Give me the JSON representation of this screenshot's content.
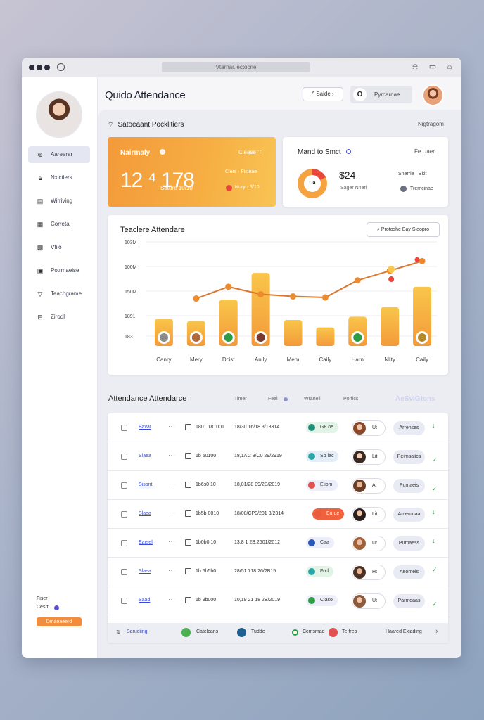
{
  "browser": {
    "url": "Vtarnar.lectocrie"
  },
  "app": {
    "title": "Quido Attendance",
    "header_button": "Saide",
    "search_placeholder": "Pyrcarnae"
  },
  "sidebar": {
    "items": [
      {
        "label": "Aareerar",
        "icon": "plus-circle-icon",
        "active": true
      },
      {
        "label": "Nxictiers",
        "icon": "lock-icon"
      },
      {
        "label": "Wirriving",
        "icon": "calendar-icon"
      },
      {
        "label": "Corretal",
        "icon": "calendar-grid-icon"
      },
      {
        "label": "Vtiio",
        "icon": "grid-icon"
      },
      {
        "label": "Potrmaeise",
        "icon": "image-icon"
      },
      {
        "label": "Teachgrame",
        "icon": "shield-icon"
      },
      {
        "label": "Zirodl",
        "icon": "inbox-icon"
      }
    ],
    "footer_line1": "Fiser",
    "footer_line2": "Cesrt",
    "footer_button": "Dmaeaeerd"
  },
  "overview": {
    "title": "Satoeaant Pocklitiers",
    "right_label": "Nigtragom"
  },
  "card_orange": {
    "title": "Nairmaly",
    "right": "Ciease ∷",
    "big_value": "12 ⁴ 178",
    "sub": "Sature 10/10",
    "meta1": "Clers · Fisieae",
    "meta2": "Nury · 3/10"
  },
  "card_white": {
    "title": "Mand to Smct",
    "right": "Fe Uaer",
    "donut_label": "Ua",
    "big_value": "$24",
    "sub": "Sager Nnerl",
    "meta1": "Snerrie · Bkit",
    "meta2": "Tremcinae"
  },
  "chart": {
    "title": "Teaclere Attendare",
    "button": "Protoshe Bay Sleopro"
  },
  "chart_data": {
    "type": "bar",
    "categories": [
      "Canry",
      "Mery",
      "Dcist",
      "Auily",
      "Mem",
      "Caily",
      "Harn",
      "Nlity",
      "Caily"
    ],
    "ytick_labels": [
      "103M",
      "100M",
      "150M",
      "1891",
      "183"
    ],
    "ylim": [
      0,
      100
    ],
    "series": [
      {
        "values": [
          28,
          26,
          46,
          71,
          27,
          20,
          30,
          39,
          58
        ]
      },
      {
        "values": [
          null,
          47,
          58,
          51,
          49,
          48,
          64,
          73,
          82
        ]
      }
    ],
    "colors": {
      "bar": "#f6a93c",
      "line": "#d9782e",
      "dot_red": "#e9473a",
      "dot_gold": "#f9c74a"
    }
  },
  "table": {
    "title": "Attendance Attendarce",
    "headers": [
      "Timer",
      "Feal",
      "Wranell",
      "Porfics"
    ],
    "right_label": "AeSvIGtons",
    "rows": [
      {
        "link": "Bavat",
        "time": "1801 181001",
        "range": "18/30 16/18.3/18314",
        "status": "G8 oe",
        "status_color": "#1f8f7a",
        "status_bg": "#e2f4e6",
        "user": "Ut",
        "action": "Arrenses"
      },
      {
        "link": "Slaea",
        "time": "1b 50100",
        "range": "18,1A 2 8/C0 29/2919",
        "status": "Sb lac",
        "status_color": "#2aa6a6",
        "status_bg": "#e4eef8",
        "user": "Lit",
        "action": "Peimsalics"
      },
      {
        "link": "Sisant",
        "time": "1b6s0 10",
        "range": "18,01/28 09/2B/2019",
        "status": "Eliom",
        "status_color": "#e0504e",
        "status_bg": "#eceefa",
        "user": "Al",
        "action": "Pumaeis"
      },
      {
        "link": "Slaea",
        "time": "1b5b 0010",
        "range": "18/00/CP0/201 3/2314",
        "status": "Bu ue",
        "status_color": "#ea5a3d",
        "status_bg": "#f0623e",
        "user": "Lit",
        "action": "Amemnaa"
      },
      {
        "link": "Earsel",
        "time": "1b0b0 10",
        "range": "13,8 1 2B.2601/2012",
        "status": "Caa",
        "status_color": "#2857b8",
        "status_bg": "#eceefa",
        "user": "Ut",
        "action": "Pumaess"
      },
      {
        "link": "Slaea",
        "time": "1b 5b5b0",
        "range": "28/51 718.26/2B15",
        "status": "Fod",
        "status_color": "#2aa6a6",
        "status_bg": "#e2f4e6",
        "user": "Ht",
        "action": "Aeomels"
      },
      {
        "link": "Saad",
        "time": "1b 9b000",
        "range": "10,19 21 18 2B/2019",
        "status": "Claso",
        "status_color": "#2e9c45",
        "status_bg": "#eceefa",
        "user": "Ut",
        "action": "Parmdaas"
      }
    ],
    "footer": {
      "item1": "Sarudiing",
      "item2": "Catelcans",
      "item3": "Tudde",
      "item4": "Ccmsmad",
      "item5": "Te frep",
      "item6": "Haared Exiading"
    }
  }
}
